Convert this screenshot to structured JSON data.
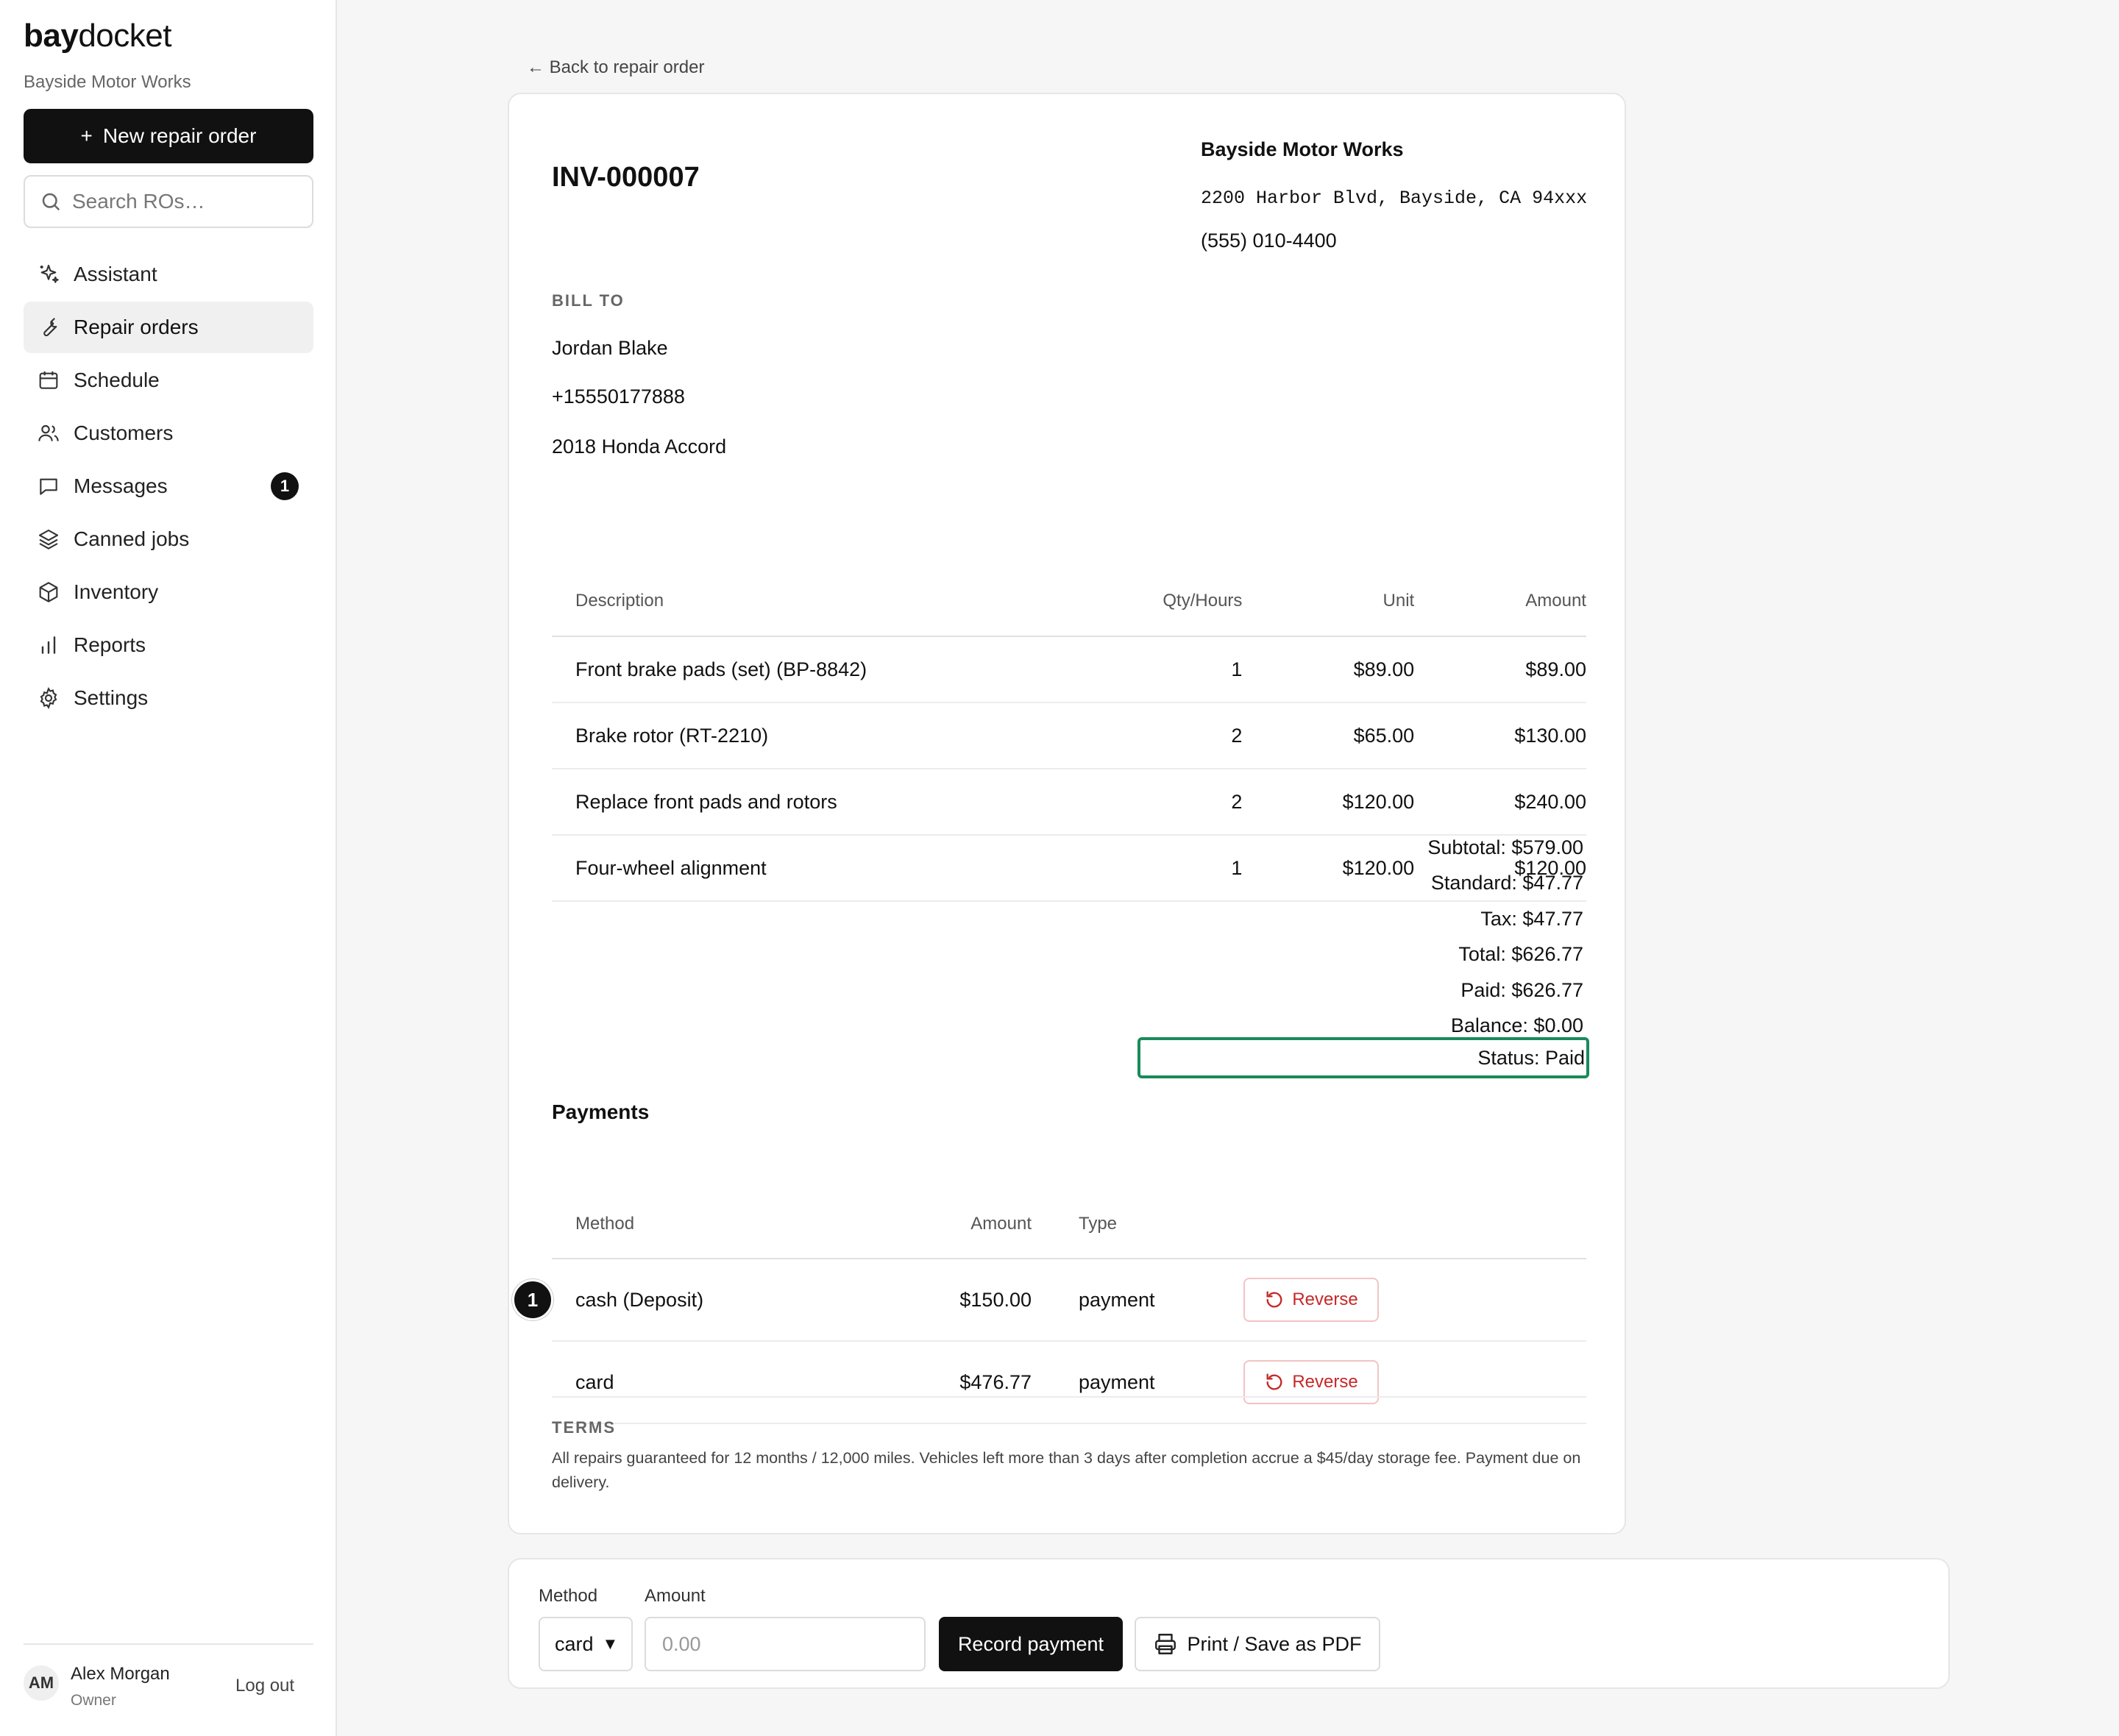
{
  "sidebar": {
    "brand_bold": "bay",
    "brand_rest": "docket",
    "shop_name": "Bayside Motor Works",
    "new_ro_label": "New repair order",
    "search_placeholder": "Search ROs…",
    "items": [
      {
        "label": "Assistant",
        "icon": "sparkle-icon"
      },
      {
        "label": "Repair orders",
        "icon": "wrench-icon",
        "active": true
      },
      {
        "label": "Schedule",
        "icon": "calendar-icon"
      },
      {
        "label": "Customers",
        "icon": "users-icon"
      },
      {
        "label": "Messages",
        "icon": "message-icon",
        "badge": "1"
      },
      {
        "label": "Canned jobs",
        "icon": "layers-icon"
      },
      {
        "label": "Inventory",
        "icon": "box-icon"
      },
      {
        "label": "Reports",
        "icon": "bar-chart-icon"
      },
      {
        "label": "Settings",
        "icon": "gear-icon"
      }
    ],
    "user": {
      "initials": "AM",
      "name": "Alex Morgan",
      "role": "Owner",
      "logout": "Log out"
    }
  },
  "back_link": "← Back to repair order",
  "invoice": {
    "number": "INV-000007",
    "shop": {
      "name": "Bayside Motor Works",
      "address": "2200 Harbor Blvd, Bayside, CA 94xxx",
      "phone": "(555) 010-4400"
    },
    "bill_to_label": "BILL TO",
    "bill_to": {
      "name": "Jordan Blake",
      "phone": "+15550177888",
      "vehicle": "2018 Honda Accord"
    },
    "line_headers": {
      "description": "Description",
      "qty": "Qty/Hours",
      "unit": "Unit",
      "amount": "Amount"
    },
    "lines": [
      {
        "description": "Front brake pads (set) (BP-8842)",
        "qty": "1",
        "unit": "$89.00",
        "amount": "$89.00"
      },
      {
        "description": "Brake rotor (RT-2210)",
        "qty": "2",
        "unit": "$65.00",
        "amount": "$130.00"
      },
      {
        "description": "Replace front pads and rotors",
        "qty": "2",
        "unit": "$120.00",
        "amount": "$240.00"
      },
      {
        "description": "Four-wheel alignment",
        "qty": "1",
        "unit": "$120.00",
        "amount": "$120.00"
      }
    ],
    "totals": {
      "subtotal": "Subtotal: $579.00",
      "standard": "Standard: $47.77",
      "tax": "Tax: $47.77",
      "total": "Total: $626.77",
      "paid": "Paid: $626.77",
      "balance": "Balance: $0.00",
      "status": "Status: Paid"
    },
    "status_color": "#1a8a5a",
    "payments_title": "Payments",
    "payment_headers": {
      "method": "Method",
      "amount": "Amount",
      "type": "Type"
    },
    "payments": [
      {
        "method": "cash (Deposit)",
        "amount": "$150.00",
        "type": "payment",
        "action": "Reverse",
        "marker": "1"
      },
      {
        "method": "card",
        "amount": "$476.77",
        "type": "payment",
        "action": "Reverse"
      }
    ],
    "terms_label": "TERMS",
    "terms_text": "All repairs guaranteed for 12 months / 12,000 miles. Vehicles left more than 3 days after completion accrue a $45/day storage fee. Payment due on delivery."
  },
  "payment_form": {
    "method_label": "Method",
    "method_value": "card",
    "amount_label": "Amount",
    "amount_placeholder": "0.00",
    "record_label": "Record payment",
    "print_label": "Print / Save as PDF"
  }
}
